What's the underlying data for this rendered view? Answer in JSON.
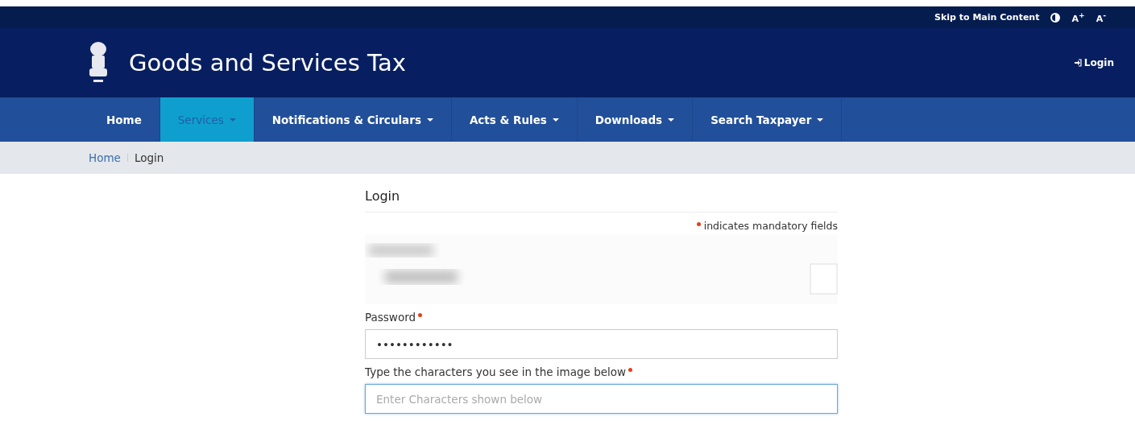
{
  "top_bar": {
    "skip_link": "Skip to Main Content",
    "font_buttons": [
      "A$^{+}$",
      "A$^{-}$"
    ]
  },
  "header": {
    "title": "Goods and Services Tax",
    "login": "Login"
  },
  "nav": [
    {
      "label": "Home",
      "selected": false,
      "dropdown": false
    },
    {
      "label": "Services",
      "selected": true,
      "dropdown": true
    },
    {
      "label": "Notifications & Circulars",
      "selected": false,
      "dropdown": true
    },
    {
      "label": "Acts & Rules",
      "selected": false,
      "dropdown": true
    },
    {
      "label": "Downloads",
      "selected": false,
      "dropdown": true
    },
    {
      "label": "Search Taxpayer",
      "selected": false,
      "dropdown": true
    }
  ],
  "breadcrumb": [
    "Home",
    "Login"
  ],
  "form": {
    "title": "Login",
    "mandatory_note": "indicates mandatory fields",
    "fields": [
      {
        "label": "Password",
        "required": true,
        "value": "••••••••••••",
        "focused": false
      },
      {
        "label": "Type the characters you see in the image below",
        "required": true,
        "placeholder": "Enter Characters shown below",
        "focused": true
      }
    ]
  }
}
